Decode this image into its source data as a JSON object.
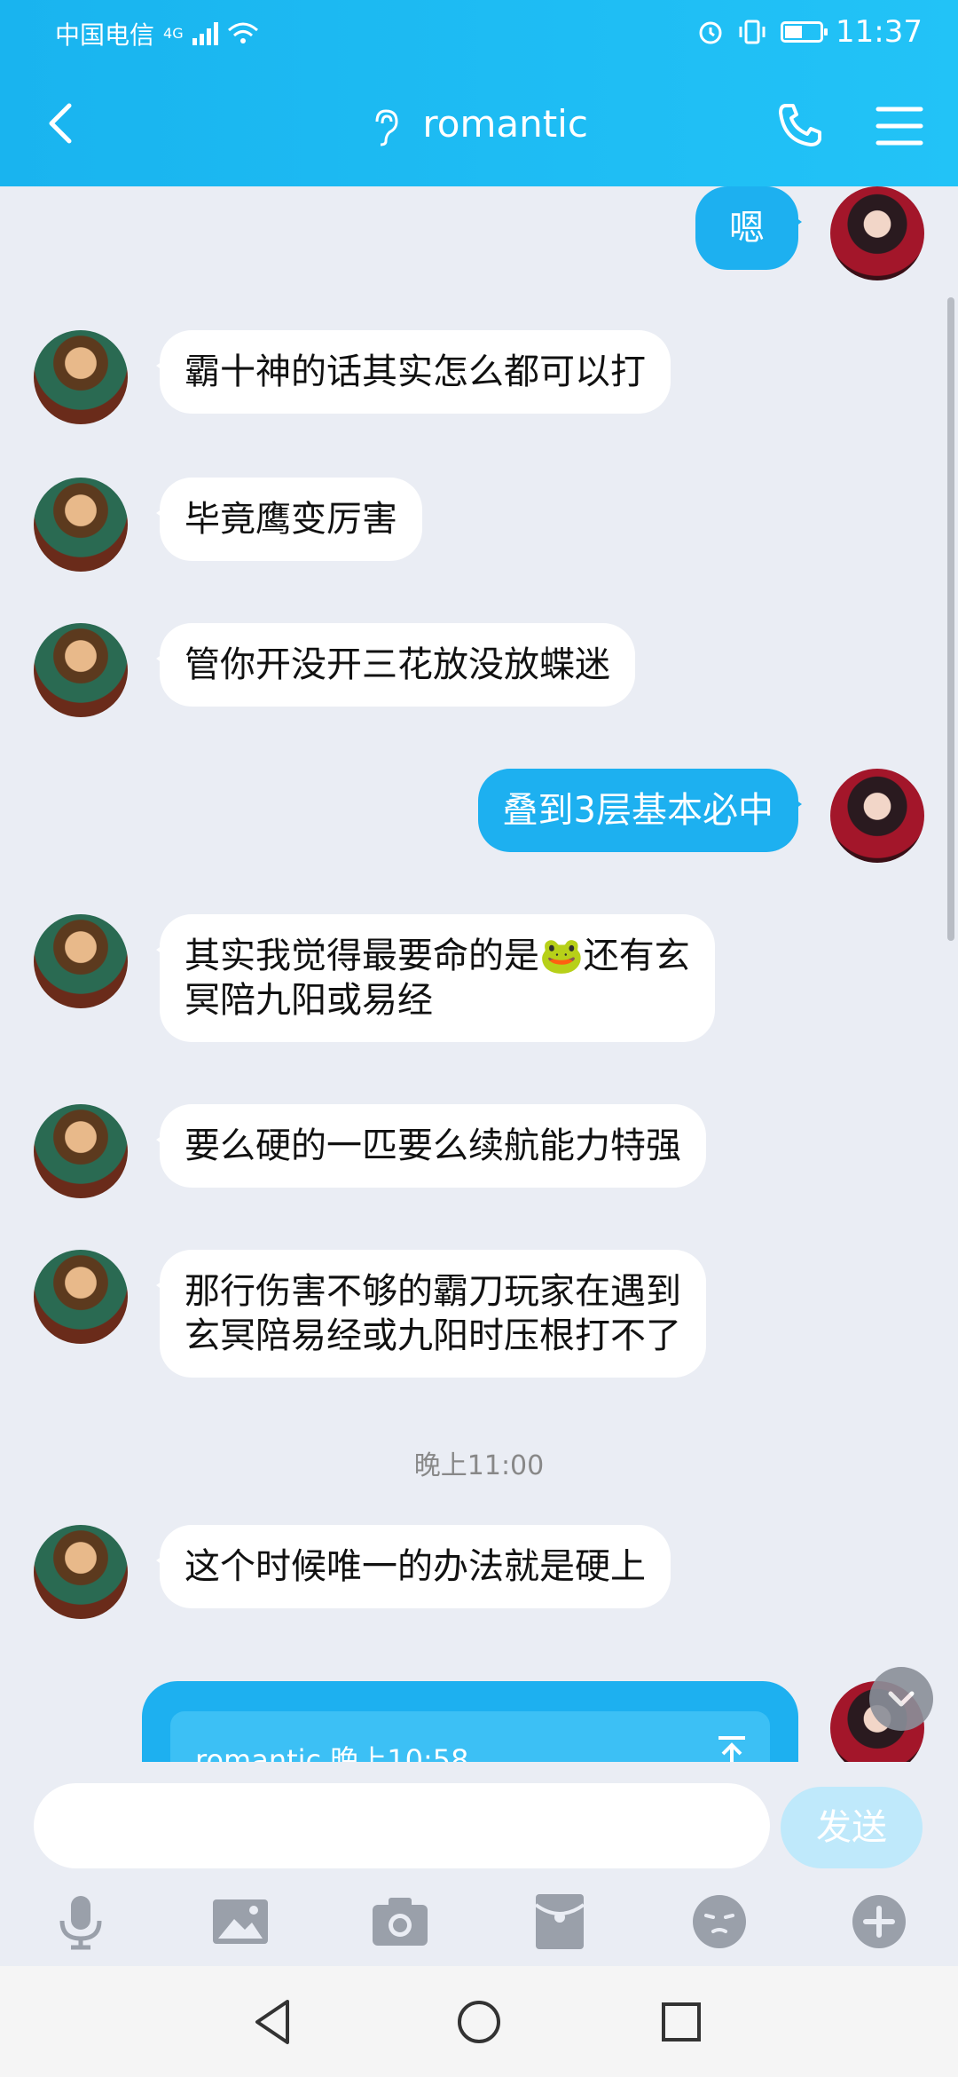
{
  "status": {
    "carrier": "中国电信",
    "network": "4G",
    "time": "11:37"
  },
  "header": {
    "title": "romantic"
  },
  "messages": [
    {
      "side": "out",
      "text": "嗯"
    },
    {
      "side": "in",
      "text": "霸十神的话其实怎么都可以打"
    },
    {
      "side": "in",
      "text": "毕竟鹰变厉害"
    },
    {
      "side": "in",
      "text": "管你开没开三花放没放蝶迷"
    },
    {
      "side": "out",
      "text": "叠到3层基本必中"
    },
    {
      "side": "in",
      "line1": "其实我觉得最要命的是🐸还有玄",
      "line2": "冥陪九阳或易经"
    },
    {
      "side": "in",
      "text": "要么硬的一匹要么续航能力特强"
    },
    {
      "side": "in",
      "line1": "那行伤害不够的霸刀玩家在遇到",
      "line2": "玄冥陪易经或九阳时压根打不了"
    },
    {
      "side": "in",
      "text": "这个时候唯一的办法就是硬上"
    }
  ],
  "time_divider": "晚上11:00",
  "quote": {
    "text": "romantic 晚上10:58"
  },
  "input": {
    "placeholder": "",
    "send_label": "发送"
  },
  "colors": {
    "header": "#1db9f2",
    "bubble_out": "#1db0f0",
    "bubble_in": "#ffffff",
    "background": "#eaedf4"
  }
}
